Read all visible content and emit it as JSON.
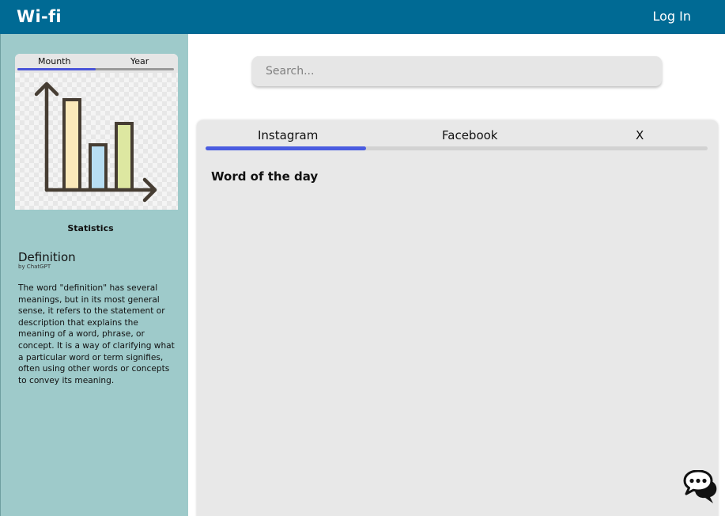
{
  "header": {
    "brand": "Wi-fi",
    "login_label": "Log In"
  },
  "sidebar": {
    "stats_card": {
      "tabs": [
        "Mounth",
        "Year"
      ],
      "active_tab": "Mounth",
      "progress": 0.5,
      "chart_icon": "bar-chart-icon"
    },
    "stats_caption": "Statistics",
    "definition": {
      "title": "Definition",
      "byline": "by ChatGPT",
      "body": "The word \"definition\" has several meanings, but in its most general sense, it refers to the statement or description that explains the meaning of a word, phrase, or concept. It is a way of clarifying what a particular word or term signifies, often using other words or concepts to convey its meaning."
    }
  },
  "search": {
    "placeholder": "Search...",
    "value": ""
  },
  "panel": {
    "tabs": [
      "Instagram",
      "Facebook",
      "X"
    ],
    "active_tab": "Instagram",
    "progress": 0.32,
    "heading": "Word of the day"
  },
  "icons": {
    "chat": "chat-bubbles-icon"
  },
  "colors": {
    "header": "#006a94",
    "sidebar": "#9ecaca",
    "accent": "#4a5ce0",
    "panel": "#e8e8e8"
  }
}
